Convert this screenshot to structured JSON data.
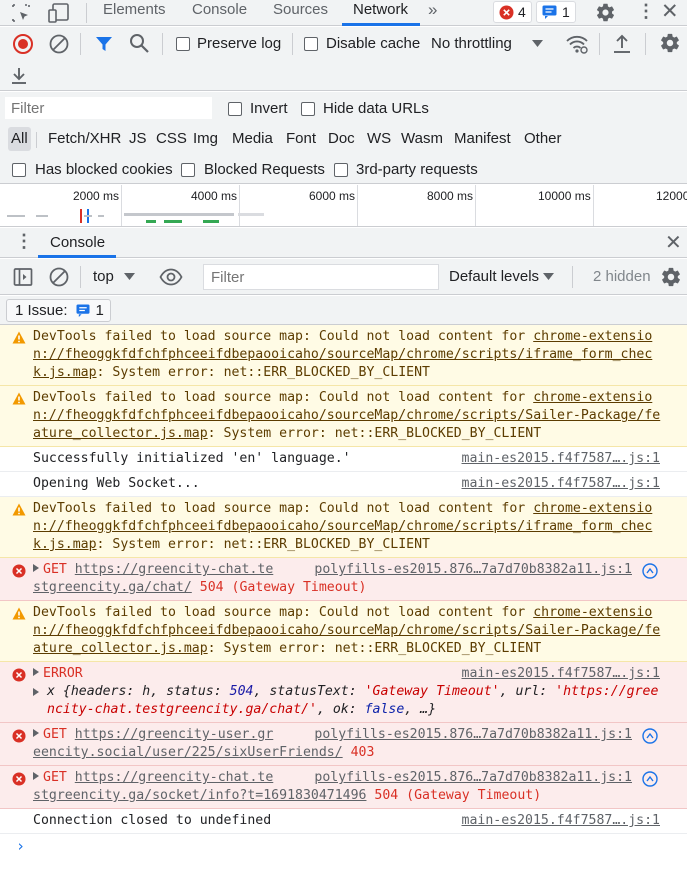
{
  "tabs": {
    "elements": "Elements",
    "console": "Console",
    "sources": "Sources",
    "network": "Network",
    "error_count": "4",
    "issue_count": "1"
  },
  "network_toolbar": {
    "preserve_log": "Preserve log",
    "disable_cache": "Disable cache",
    "throttling": "No throttling"
  },
  "filter_bar": {
    "filter_placeholder": "Filter",
    "invert": "Invert",
    "hide_data_urls": "Hide data URLs",
    "types": [
      "All",
      "Fetch/XHR",
      "JS",
      "CSS",
      "Img",
      "Media",
      "Font",
      "Doc",
      "WS",
      "Wasm",
      "Manifest",
      "Other"
    ],
    "has_blocked_cookies": "Has blocked cookies",
    "blocked_requests": "Blocked Requests",
    "third_party": "3rd-party requests"
  },
  "timeline": {
    "ticks": [
      "2000 ms",
      "4000 ms",
      "6000 ms",
      "8000 ms",
      "10000 ms",
      "12000"
    ]
  },
  "drawer": {
    "title": "Console"
  },
  "console_toolbar": {
    "context": "top",
    "filter_placeholder": "Filter",
    "levels": "Default levels",
    "hidden": "2 hidden"
  },
  "issues_bar": {
    "label": "1 Issue:",
    "count": "1"
  },
  "messages": [
    {
      "level": "warning",
      "prefix": "DevTools failed to load source map: Could not load content for ",
      "link": "chrome-extension://fheoggkfdfchfphceeifdbepaooicaho/sourceMap/chrome/scripts/iframe_form_check.js.map",
      "suffix": ": System error: net::ERR_BLOCKED_BY_CLIENT"
    },
    {
      "level": "warning",
      "prefix": "DevTools failed to load source map: Could not load content for ",
      "link": "chrome-extension://fheoggkfdfchfphceeifdbepaooicaho/sourceMap/chrome/scripts/Sailer-Package/feature_collector.js.map",
      "suffix": ": System error: net::ERR_BLOCKED_BY_CLIENT"
    },
    {
      "level": "info",
      "text": "Successfully initialized 'en' language.'",
      "source": "main-es2015.f4f7587….js:1"
    },
    {
      "level": "info",
      "text": "Opening Web Socket...",
      "source": "main-es2015.f4f7587….js:1"
    },
    {
      "level": "warning",
      "prefix": "DevTools failed to load source map: Could not load content for ",
      "link": "chrome-extension://fheoggkfdfchfphceeifdbepaooicaho/sourceMap/chrome/scripts/iframe_form_check.js.map",
      "suffix": ": System error: net::ERR_BLOCKED_BY_CLIENT"
    },
    {
      "level": "error",
      "method": "GET",
      "url_part1": "https://greencity-chat.te",
      "url_part2": "stgreencity.ga/chat/",
      "status": "504 (Gateway Timeout)",
      "source": "polyfills-es2015.876…7a7d70b8382a11.js:1"
    },
    {
      "level": "warning",
      "prefix": "DevTools failed to load source map: Could not load content for ",
      "link": "chrome-extension://fheoggkfdfchfphceeifdbepaooicaho/sourceMap/chrome/scripts/Sailer-Package/feature_collector.js.map",
      "suffix": ": System error: net::ERR_BLOCKED_BY_CLIENT"
    },
    {
      "level": "error",
      "kind": "object",
      "title": "ERROR",
      "source": "main-es2015.f4f7587….js:1",
      "obj_open": "x {headers: h, status: ",
      "obj_status": "504",
      "obj_mid": ", statusText: ",
      "obj_statustext": "'Gateway Timeout'",
      "obj_mid2": ", url: ",
      "obj_url": "'https://greencity-chat.testgreencity.ga/chat/'",
      "obj_mid3": ", ok: ",
      "obj_ok": "false",
      "obj_end": ", …}"
    },
    {
      "level": "error",
      "method": "GET",
      "url_part1": "https://greencity-user.gr",
      "url_part2": "eencity.social/user/225/sixUserFriends/",
      "status": "403",
      "source": "polyfills-es2015.876…7a7d70b8382a11.js:1"
    },
    {
      "level": "error",
      "method": "GET",
      "url_part1": "https://greencity-chat.te",
      "url_part2": "stgreencity.ga/socket/info?t=1691830471496",
      "status": "504 (Gateway Timeout)",
      "source": "polyfills-es2015.876…7a7d70b8382a11.js:1"
    },
    {
      "level": "info",
      "text": "Connection closed to undefined",
      "source": "main-es2015.f4f7587….js:1"
    }
  ],
  "colors": {
    "accent": "#1a73e8",
    "error": "#d93025",
    "warning": "#f29900",
    "record": "#d93025"
  }
}
